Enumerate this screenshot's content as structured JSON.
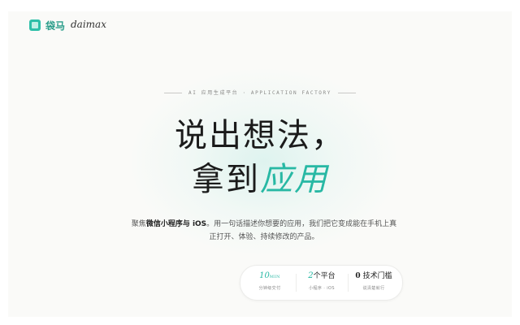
{
  "brand": {
    "name_cn": "袋马",
    "name_en": "daimax"
  },
  "hero": {
    "eyebrow": "AI 应用生成平台 · APPLICATION FACTORY",
    "line1": "说出想法，",
    "line2_prefix": "拿到",
    "line2_accent": "应用",
    "desc_1": "聚焦",
    "desc_bold": "微信小程序与 iOS",
    "desc_2": "。用一句话描述你想要的应用，我们把它变成能在手机上真正打开、体验、持续修改的产品。"
  },
  "stats": [
    {
      "num": "10",
      "unit": "MIN",
      "text": "",
      "caption": "分钟级交付"
    },
    {
      "num": "2",
      "unit": "",
      "text": "个平台",
      "caption": "小程序 · iOS"
    },
    {
      "num": "0",
      "unit": "",
      "text": "技术门槛",
      "caption": "说清楚就行"
    }
  ],
  "colors": {
    "accent": "#28b8a4",
    "text": "#1b1b1b",
    "background": "#fafaf8"
  }
}
